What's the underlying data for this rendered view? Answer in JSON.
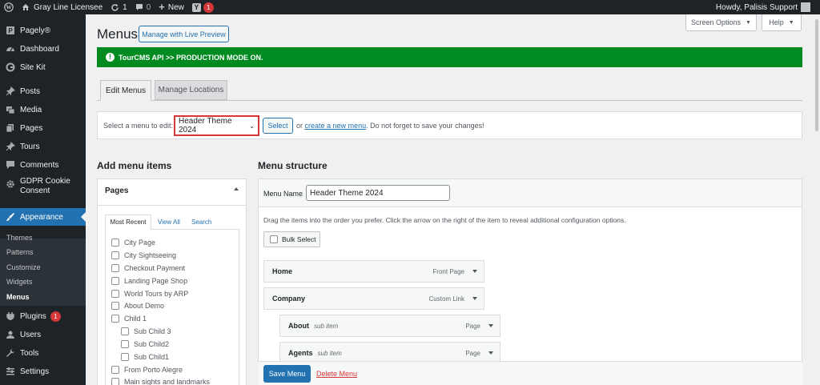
{
  "adminbar": {
    "site_name": "Gray Line Licensee",
    "updates_count": "1",
    "comments_count": "0",
    "new_label": "New",
    "notifications_count": "1",
    "howdy": "Howdy, Palisis Support"
  },
  "sidebar": {
    "items": [
      {
        "label": "Pagely®",
        "icon": "pagely-icon"
      },
      {
        "label": "Dashboard",
        "icon": "dashboard-icon"
      },
      {
        "label": "Site Kit",
        "icon": "google-icon"
      },
      {
        "label": "Posts",
        "icon": "pin-icon"
      },
      {
        "label": "Media",
        "icon": "media-icon"
      },
      {
        "label": "Pages",
        "icon": "pages-icon"
      },
      {
        "label": "Tours",
        "icon": "pin-icon"
      },
      {
        "label": "Comments",
        "icon": "comment-icon"
      },
      {
        "label": "GDPR Cookie\nConsent",
        "icon": "gear-icon"
      },
      {
        "label": "Appearance",
        "icon": "brush-icon"
      },
      {
        "label": "Plugins",
        "icon": "plug-icon",
        "badge": "1"
      },
      {
        "label": "Users",
        "icon": "user-icon"
      },
      {
        "label": "Tools",
        "icon": "wrench-icon"
      },
      {
        "label": "Settings",
        "icon": "settings-icon"
      }
    ],
    "submenu": [
      "Themes",
      "Patterns",
      "Customize",
      "Widgets",
      "Menus"
    ]
  },
  "header": {
    "title": "Menus",
    "live_preview": "Manage with Live Preview",
    "screen_options": "Screen Options",
    "help": "Help"
  },
  "notice": "TourCMS API >> PRODUCTION MODE ON.",
  "tabs": {
    "edit": "Edit Menus",
    "locations": "Manage Locations"
  },
  "select_bar": {
    "label": "Select a menu to edit:",
    "selected": "Header Theme 2024",
    "select_button": "Select",
    "or_text": "or",
    "create_link": "create a new menu",
    "rest": ". Do not forget to save your changes!"
  },
  "add_items": {
    "heading": "Add menu items",
    "pages_title": "Pages",
    "tabs": [
      "Most Recent",
      "View All",
      "Search"
    ],
    "pages": [
      {
        "label": "City Page",
        "indent": 0
      },
      {
        "label": "City Sightseeing",
        "indent": 0
      },
      {
        "label": "Checkout Payment",
        "indent": 0
      },
      {
        "label": "Landing Page Shop",
        "indent": 0
      },
      {
        "label": "World Tours by ARP",
        "indent": 0
      },
      {
        "label": "About Demo",
        "indent": 0
      },
      {
        "label": "Child 1",
        "indent": 0
      },
      {
        "label": "Sub Child 3",
        "indent": 1
      },
      {
        "label": "Sub Child2",
        "indent": 1
      },
      {
        "label": "Sub Child1",
        "indent": 1
      },
      {
        "label": "From Porto Alegre",
        "indent": 0
      },
      {
        "label": "Main sights and landmarks",
        "indent": 0
      }
    ]
  },
  "structure": {
    "heading": "Menu structure",
    "menu_name_label": "Menu Name",
    "menu_name_value": "Header Theme 2024",
    "instructions": "Drag the items into the order you prefer. Click the arrow on the right of the item to reveal additional configuration options.",
    "bulk_select": "Bulk Select",
    "items": [
      {
        "title": "Home",
        "sub": "",
        "type": "Front Page"
      },
      {
        "title": "Company",
        "sub": "",
        "type": "Custom Link"
      },
      {
        "title": "About",
        "sub": "sub item",
        "type": "Page"
      },
      {
        "title": "Agents",
        "sub": "sub item",
        "type": "Page"
      }
    ],
    "save": "Save Menu",
    "delete": "Delete Menu"
  },
  "colors": {
    "accent": "#2271b1",
    "notice": "#008a20",
    "highlight": "#d63638"
  }
}
